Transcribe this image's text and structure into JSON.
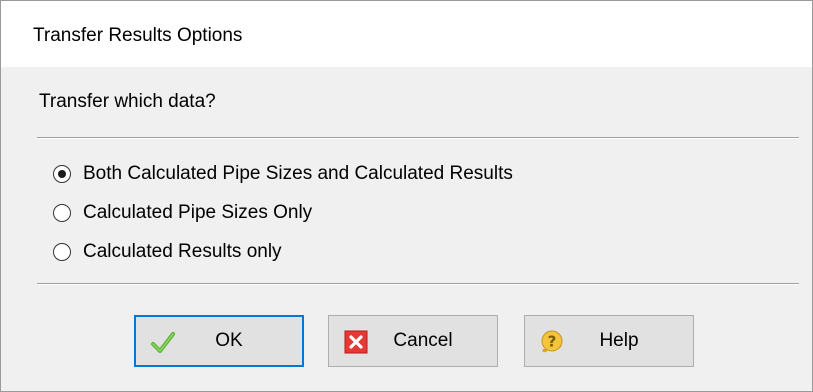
{
  "window": {
    "title": "Transfer Results Options"
  },
  "main": {
    "question": "Transfer which data?",
    "options": [
      {
        "label": "Both Calculated Pipe Sizes and Calculated Results",
        "checked": true
      },
      {
        "label": "Calculated Pipe Sizes Only",
        "checked": false
      },
      {
        "label": "Calculated Results only",
        "checked": false
      }
    ]
  },
  "buttons": {
    "ok": {
      "label": "OK",
      "icon": "checkmark-icon",
      "focused": true
    },
    "cancel": {
      "label": "Cancel",
      "icon": "red-x-icon"
    },
    "help": {
      "label": "Help",
      "icon": "help-question-icon"
    }
  },
  "colors": {
    "focus_border": "#0078d7",
    "check_green": "#5bb52f",
    "cancel_red": "#e53935",
    "help_yellow": "#f2c53d"
  }
}
